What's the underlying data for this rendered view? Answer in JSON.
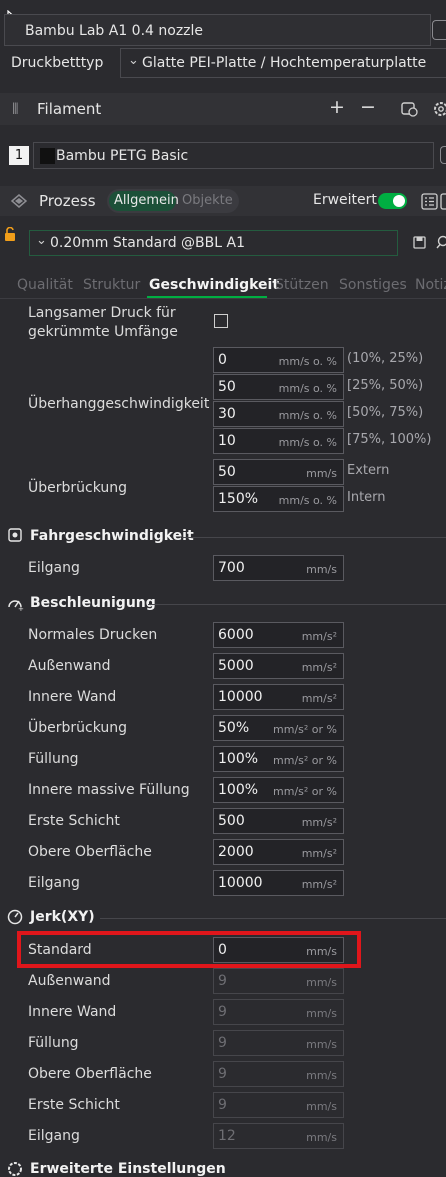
{
  "printer": {
    "name": "Bambu Lab A1 0.4 nozzle"
  },
  "bed": {
    "label": "Druckbetttyp",
    "value": "Glatte PEI-Platte / Hochtemperaturplatte"
  },
  "filament": {
    "title": "Filament",
    "slot": "1",
    "name": "Bambu PETG Basic"
  },
  "process": {
    "title": "Prozess",
    "seg_general": "Allgemein",
    "seg_objects": "Objekte",
    "advanced_label": "Erweitert",
    "preset": "0.20mm Standard @BBL A1"
  },
  "tabs": [
    "Qualität",
    "Struktur",
    "Geschwindigkeit",
    "Stützen",
    "Sonstiges",
    "Notiz"
  ],
  "speed": {
    "slow_label": "Langsamer Druck für gekrümmte Umfänge",
    "overhang_label": "Überhanggeschwindigkeit",
    "overhang": [
      {
        "value": "0",
        "unit": "mm/s o. %",
        "range": "(10%, 25%)"
      },
      {
        "value": "50",
        "unit": "mm/s o. %",
        "range": "[25%, 50%)"
      },
      {
        "value": "30",
        "unit": "mm/s o. %",
        "range": "[50%, 75%)"
      },
      {
        "value": "10",
        "unit": "mm/s o. %",
        "range": "[75%, 100%)"
      }
    ],
    "bridge_label": "Überbrückung",
    "bridge": [
      {
        "value": "50",
        "unit": "mm/s",
        "range": "Extern"
      },
      {
        "value": "150%",
        "unit": "mm/s o. %",
        "range": "Intern"
      }
    ]
  },
  "travel": {
    "title": "Fahrgeschwindigkeit",
    "rows": [
      {
        "label": "Eilgang",
        "value": "700",
        "unit": "mm/s"
      }
    ]
  },
  "accel": {
    "title": "Beschleunigung",
    "rows": [
      {
        "label": "Normales Drucken",
        "value": "6000",
        "unit": "mm/s²"
      },
      {
        "label": "Außenwand",
        "value": "5000",
        "unit": "mm/s²"
      },
      {
        "label": "Innere Wand",
        "value": "10000",
        "unit": "mm/s²"
      },
      {
        "label": "Überbrückung",
        "value": "50%",
        "unit": "mm/s² or %"
      },
      {
        "label": "Füllung",
        "value": "100%",
        "unit": "mm/s² or %"
      },
      {
        "label": "Innere massive Füllung",
        "value": "100%",
        "unit": "mm/s² or %"
      },
      {
        "label": "Erste Schicht",
        "value": "500",
        "unit": "mm/s²"
      },
      {
        "label": "Obere Oberfläche",
        "value": "2000",
        "unit": "mm/s²"
      },
      {
        "label": "Eilgang",
        "value": "10000",
        "unit": "mm/s²"
      }
    ]
  },
  "jerk": {
    "title": "Jerk(XY)",
    "rows": [
      {
        "label": "Standard",
        "value": "0",
        "unit": "mm/s"
      },
      {
        "label": "Außenwand",
        "value": "9",
        "unit": "mm/s"
      },
      {
        "label": "Innere Wand",
        "value": "9",
        "unit": "mm/s"
      },
      {
        "label": "Füllung",
        "value": "9",
        "unit": "mm/s"
      },
      {
        "label": "Obere Oberfläche",
        "value": "9",
        "unit": "mm/s"
      },
      {
        "label": "Erste Schicht",
        "value": "9",
        "unit": "mm/s"
      },
      {
        "label": "Eilgang",
        "value": "12",
        "unit": "mm/s"
      }
    ]
  },
  "advanced_settings": {
    "title": "Erweiterte Einstellungen"
  },
  "colors": {
    "accent": "#00ae42",
    "highlight": "#e0161b",
    "filament_swatch": "#111111"
  }
}
